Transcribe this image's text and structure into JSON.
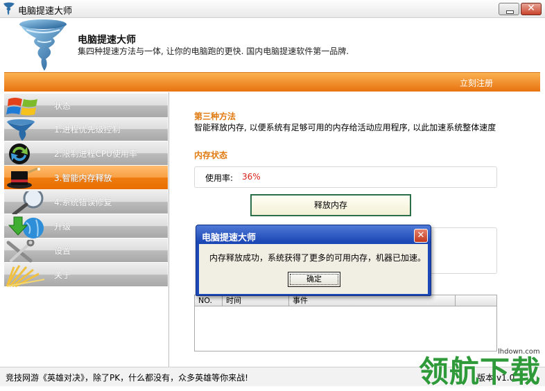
{
  "window": {
    "title": "电脑提速大师",
    "minimize_icon": "minimize-icon",
    "close_label": "✕"
  },
  "header": {
    "name": "电脑提速大师",
    "slogan": "集四种提速方法与一体, 让你的电脑跑的更快. 国内电脑提速软件第一品牌."
  },
  "topbar": {
    "register_label": "立刻注册"
  },
  "sidebar": {
    "items": [
      {
        "label": "状态",
        "icon": "windows-logo-icon",
        "active": false
      },
      {
        "label": "1.进程优先级控制",
        "icon": "tornado-icon",
        "active": false
      },
      {
        "label": "2.限制进程CPU使用率",
        "icon": "refresh-arrows-icon",
        "active": false
      },
      {
        "label": "3.智能内存释放",
        "icon": "magic-hat-icon",
        "active": true
      },
      {
        "label": "4.系统错误修复",
        "icon": "magnifier-icon",
        "active": false
      },
      {
        "label": "升级",
        "icon": "globe-download-icon",
        "active": false
      },
      {
        "label": "设置",
        "icon": "tools-icon",
        "active": false
      },
      {
        "label": "关于",
        "icon": "light-rays-icon",
        "active": false
      }
    ]
  },
  "main": {
    "method_title": "第三种方法",
    "method_desc": "智能释放内存, 以便系统有足够可用的内存给活动应用程序, 以此加速系统整体速度",
    "memory_title": "内存状态",
    "usage_label": "使用率:",
    "usage_value": "36%",
    "release_button": "释放内存",
    "log_columns": [
      "NO.",
      "时间",
      "事件",
      ""
    ]
  },
  "dialog": {
    "title": "电脑提速大师",
    "close_label": "✕",
    "message": "内存释放成功，系统获得了更多的可用内存，机器已加速。",
    "ok_label": "确定"
  },
  "statusbar": {
    "ad_text": "竞技网游《英雄对决》，除了PK，什么都没有，众多英雄等你来战!",
    "version": "版本:v1.0"
  },
  "watermark": {
    "text": "领航下载",
    "url": "lhdown.com"
  },
  "colors": {
    "accent": "#ee7c10",
    "heading": "#e07a10",
    "usage": "#d9221b",
    "dialog": "#1c48b6"
  }
}
